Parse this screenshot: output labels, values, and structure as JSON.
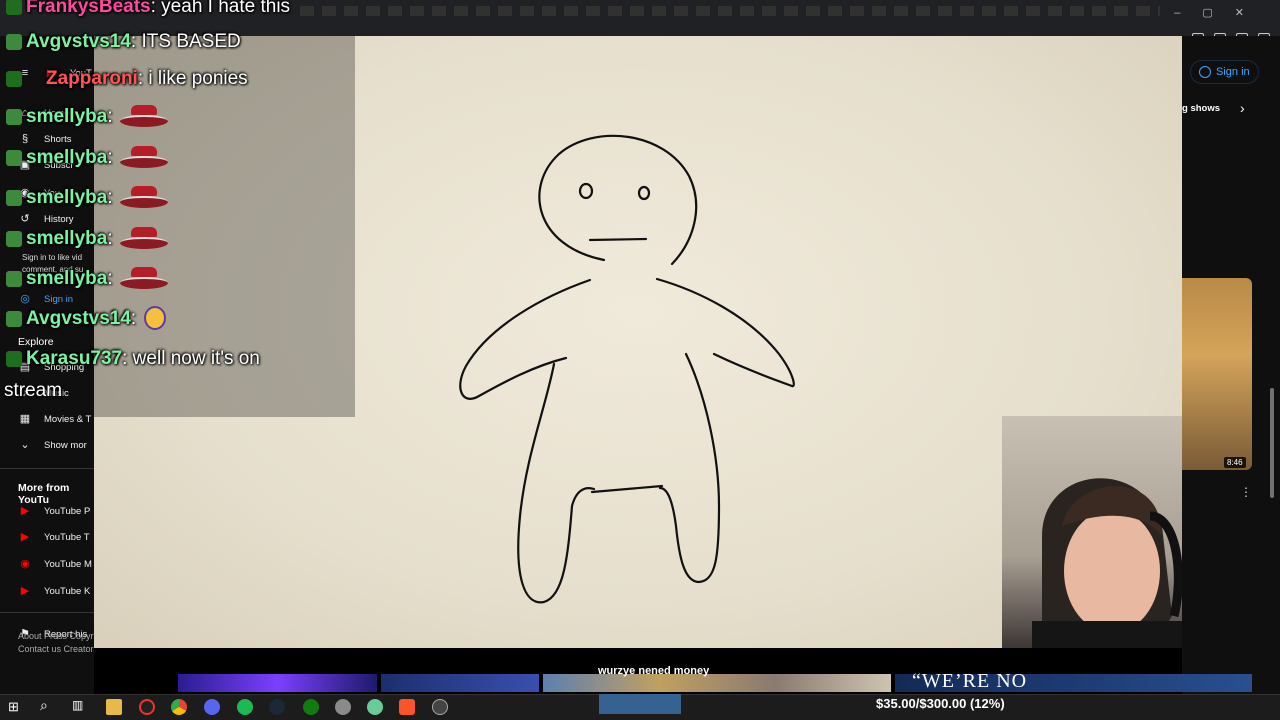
{
  "sidebar": {
    "items": [
      {
        "label": "YouT",
        "icon": "menu-icon"
      },
      {
        "label": "Home",
        "icon": "home-icon"
      },
      {
        "label": "Shorts",
        "icon": "shorts-icon"
      },
      {
        "label": "Subscr",
        "icon": "subscriptions-icon"
      },
      {
        "label": "You",
        "icon": "you-icon"
      },
      {
        "label": "History",
        "icon": "history-icon"
      }
    ],
    "signin_prompt": "Sign in to like vid comment, and su",
    "signin_label": "Sign in",
    "explore_label": "Explore",
    "explore_items": [
      {
        "label": "Shopping",
        "icon": "bag-icon"
      },
      {
        "label": "Music",
        "icon": "music-icon"
      },
      {
        "label": "Movies & T",
        "icon": "film-icon"
      },
      {
        "label": "Show mor",
        "icon": "chevron-down-icon"
      }
    ],
    "more_from_label": "More from YouTu",
    "more_items": [
      {
        "label": "YouTube P",
        "icon": "youtube-premium-icon"
      },
      {
        "label": "YouTube T",
        "icon": "youtube-tv-icon"
      },
      {
        "label": "YouTube M",
        "icon": "youtube-music-icon"
      },
      {
        "label": "YouTube K",
        "icon": "youtube-kids-icon"
      }
    ],
    "report_label": "Report his",
    "footer": "About  Press  Copyright  Contact us  Creators"
  },
  "chat": {
    "messages": [
      {
        "user": "FrankysBeats",
        "color": "#ff4aa0",
        "text": ": yeah I hate this"
      },
      {
        "user": "Avgvstvs14",
        "color": "#7cf3a0",
        "text": ": ITS BASED"
      },
      {
        "user": "Zapparoni",
        "color": "#ff5555",
        "text": ": i like ponies"
      },
      {
        "user": "smellyba",
        "color": "#7cf3a0",
        "text": ":",
        "emote": "hat"
      },
      {
        "user": "smellyba",
        "color": "#7cf3a0",
        "text": ":",
        "emote": "hat"
      },
      {
        "user": "smellyba",
        "color": "#7cf3a0",
        "text": ":",
        "emote": "hat"
      },
      {
        "user": "smellyba",
        "color": "#7cf3a0",
        "text": ":",
        "emote": "hat"
      },
      {
        "user": "smellyba",
        "color": "#7cf3a0",
        "text": ":",
        "emote": "hat"
      },
      {
        "user": "Avgvstvs14",
        "color": "#7cf3a0",
        "text": ":",
        "emote": "cat"
      },
      {
        "user": "Karasu737",
        "color": "#7cf3a0",
        "text": ": well now it's on"
      }
    ],
    "continuation": "stream"
  },
  "right_panel": {
    "signin_label": "Sign in",
    "chip_label": "g shows",
    "thumb_duration": "8:46"
  },
  "stream": {
    "caption": "wurzye nened money",
    "overlay_text": "“WE’RE NO",
    "donation": "$35.00/$300.00 (12%)",
    "donation_fraction": 0.12
  },
  "colors": {
    "paper": "#ebe4d3",
    "ink": "#111111",
    "link": "#3ea6ff"
  }
}
